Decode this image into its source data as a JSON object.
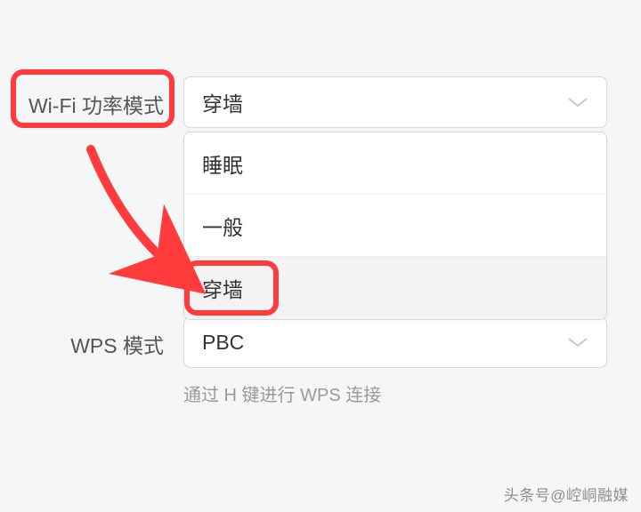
{
  "wifi_power": {
    "label": "Wi-Fi 功率模式",
    "selected": "穿墙",
    "options": [
      "睡眠",
      "一般",
      "穿墙"
    ]
  },
  "wps": {
    "label": "WPS 模式",
    "selected": "PBC",
    "helper": "通过 H 键进行 WPS 连接"
  },
  "watermark": "头条号@崆峒融媒",
  "annotation": {
    "hl_color": "#ff3b3b"
  }
}
